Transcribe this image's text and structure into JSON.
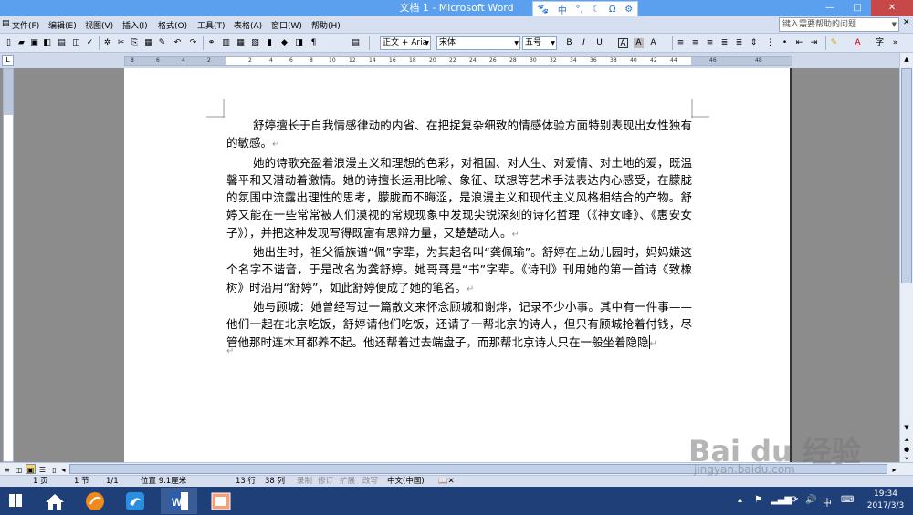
{
  "window": {
    "title": "文档 1 - Microsoft Word",
    "minimize": "—",
    "maximize": "□",
    "close": "✕"
  },
  "ime": {
    "items": [
      "🐾",
      "中",
      "°,",
      "☾",
      "Ω",
      "⚙"
    ]
  },
  "menubar": {
    "items": [
      "文件(F)",
      "编辑(E)",
      "视图(V)",
      "插入(I)",
      "格式(O)",
      "工具(T)",
      "表格(A)",
      "窗口(W)",
      "帮助(H)"
    ],
    "help_search_placeholder": "键入需要帮助的问题",
    "close_doc": "✕"
  },
  "toolbar": {
    "style_combo": "正文 + Aria",
    "font_combo": "宋体",
    "size_combo": "五号",
    "bold": "B",
    "italic": "I",
    "underline": "U",
    "char_border": "A",
    "char_shade": "A",
    "font_color": "A"
  },
  "ruler": {
    "corner": "L",
    "ticks": [
      "8",
      "6",
      "4",
      "2",
      "2",
      "4",
      "6",
      "8",
      "10",
      "12",
      "14",
      "16",
      "18",
      "20",
      "22",
      "24",
      "26",
      "28",
      "30",
      "32",
      "34",
      "36",
      "38",
      "40",
      "42",
      "44",
      "46",
      "48"
    ]
  },
  "document": {
    "paragraphs": [
      "舒婷擅长于自我情感律动的内省、在把捉复杂细致的情感体验方面特别表现出女性独有的敏感。",
      "她的诗歌充盈着浪漫主义和理想的色彩，对祖国、对人生、对爱情、对土地的爱，既温馨平和又潜动着激情。她的诗擅长运用比喻、象征、联想等艺术手法表达内心感受，在朦胧的氛围中流露出理性的思考，朦胧而不晦涩，是浪漫主义和现代主义风格相结合的产物。舒婷又能在一些常常被人们漠视的常规现象中发现尖锐深刻的诗化哲理（《神女峰》、《惠安女子》），并把这种发现写得既富有思辩力量，又楚楚动人。",
      "她出生时，祖父循族谱“佩”字辈，为其起名叫“龚佩瑜”。舒婷在上幼儿园时，妈妈嫌这个名字不谐音，于是改名为龚舒婷。她哥哥是“书”字辈。《诗刊》刊用她的第一首诗《致橡树》时沿用“舒婷”，如此舒婷便成了她的笔名。",
      "她与顾城：她曾经写过一篇散文来怀念顾城和谢烨，记录不少小事。其中有一件事——他们一起在北京吃饭，舒婷请他们吃饭，还请了一帮北京的诗人，但只有顾城抢着付钱，尽管他那时连木耳都养不起。他还帮着过去端盘子，而那帮北京诗人只在一般坐着隐隐"
    ],
    "paragraph_mark": "↵"
  },
  "statusbar": {
    "page": "1 页",
    "section": "1 节",
    "page_of": "1/1",
    "position": "位置 9.1厘米",
    "line": "13 行",
    "column": "38 列",
    "rec": "录制",
    "trk": "修订",
    "ext": "扩展",
    "ovr": "改写",
    "language": "中文(中国)"
  },
  "taskbar": {
    "time": "19:34",
    "date": "2017/3/3",
    "ime_indicator": "中"
  },
  "watermark": {
    "brand": "Bai du 经验",
    "url": "jingyan.baidu.com"
  },
  "colors": {
    "titlebar": "#5aa0ee",
    "taskbar": "#1e3f78",
    "workspace": "#8c8c8c"
  }
}
